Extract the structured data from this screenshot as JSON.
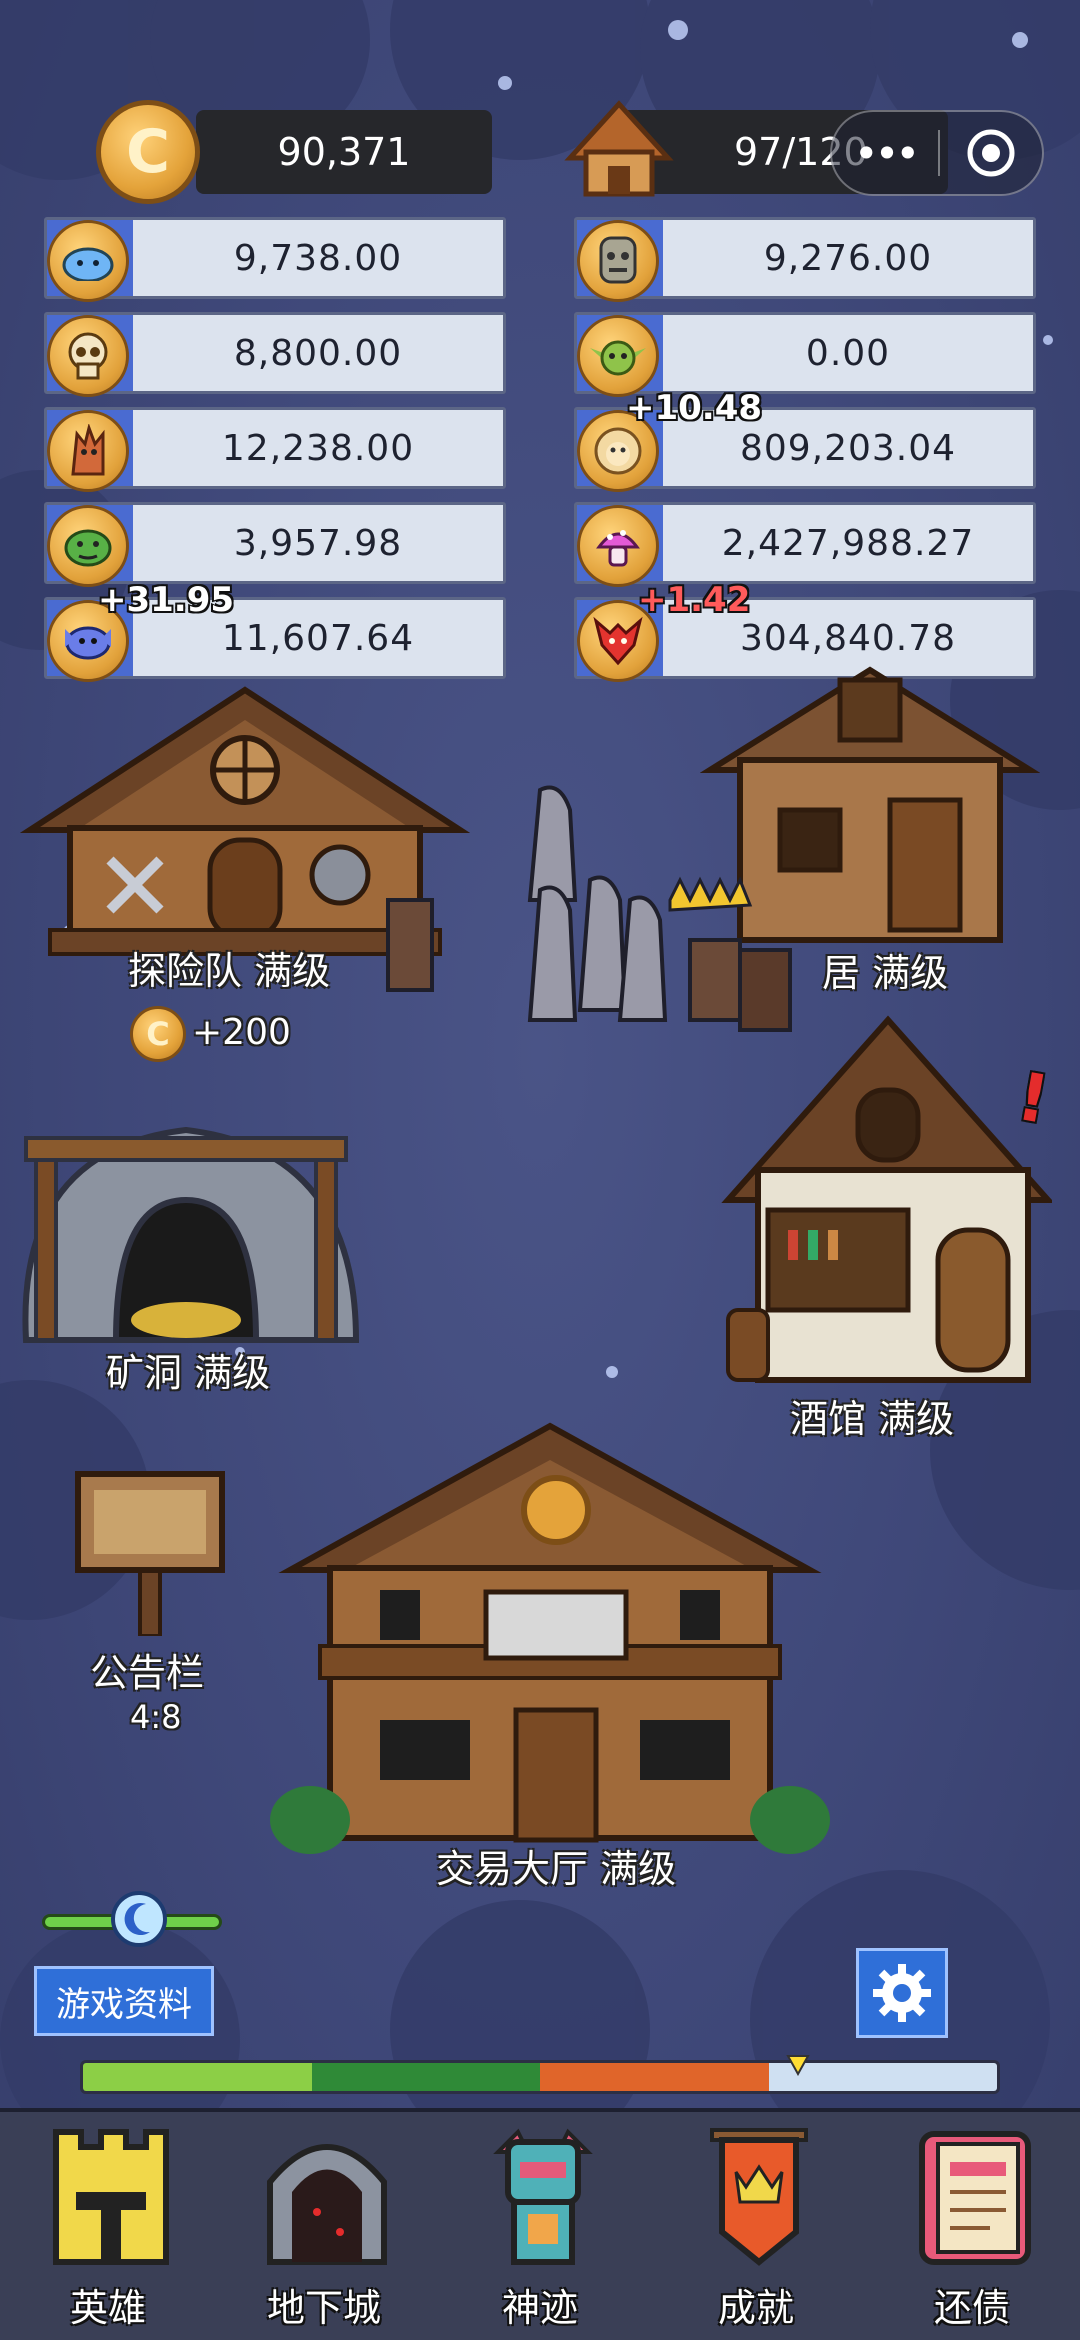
{
  "top": {
    "coins": "90,371",
    "houses": "97/120",
    "capsule_more": "•••"
  },
  "resources": [
    {
      "icon": "blue-slime-icon",
      "value": "9,738.00"
    },
    {
      "icon": "zombie-face-icon",
      "value": "9,276.00"
    },
    {
      "icon": "skull-icon",
      "value": "8,800.00"
    },
    {
      "icon": "goblin-face-icon",
      "value": "0.00"
    },
    {
      "icon": "tree-monster-icon",
      "value": "12,238.00"
    },
    {
      "icon": "lion-face-icon",
      "value": "809,203.04"
    },
    {
      "icon": "orc-face-icon",
      "value": "3,957.98"
    },
    {
      "icon": "mushroom-icon",
      "value": "2,427,988.27"
    },
    {
      "icon": "fish-monster-icon",
      "value": "11,607.64"
    },
    {
      "icon": "red-dragon-icon",
      "value": "304,840.78"
    }
  ],
  "floats": {
    "lion": "+10.48",
    "fish": "+31.95",
    "dragon": "+1.42"
  },
  "buildings": {
    "expedition": "探险队  满级",
    "residence": "居  满级",
    "mine": "矿洞  满级",
    "tavern": "酒馆  满级",
    "board": "公告栏",
    "board_time": "4:8",
    "trade_hall": "交易大厅  满级"
  },
  "coin_reward": "+200",
  "alert_mark": "!",
  "buttons": {
    "game_info": "游戏资料"
  },
  "nav": [
    {
      "label": "英雄"
    },
    {
      "label": "地下城"
    },
    {
      "label": "神迹"
    },
    {
      "label": "成就"
    },
    {
      "label": "还债"
    }
  ],
  "colors": {
    "blue_button": "#2f6fd8",
    "coin_gold": "#e4a33a",
    "float_red": "#ff5b5b"
  }
}
